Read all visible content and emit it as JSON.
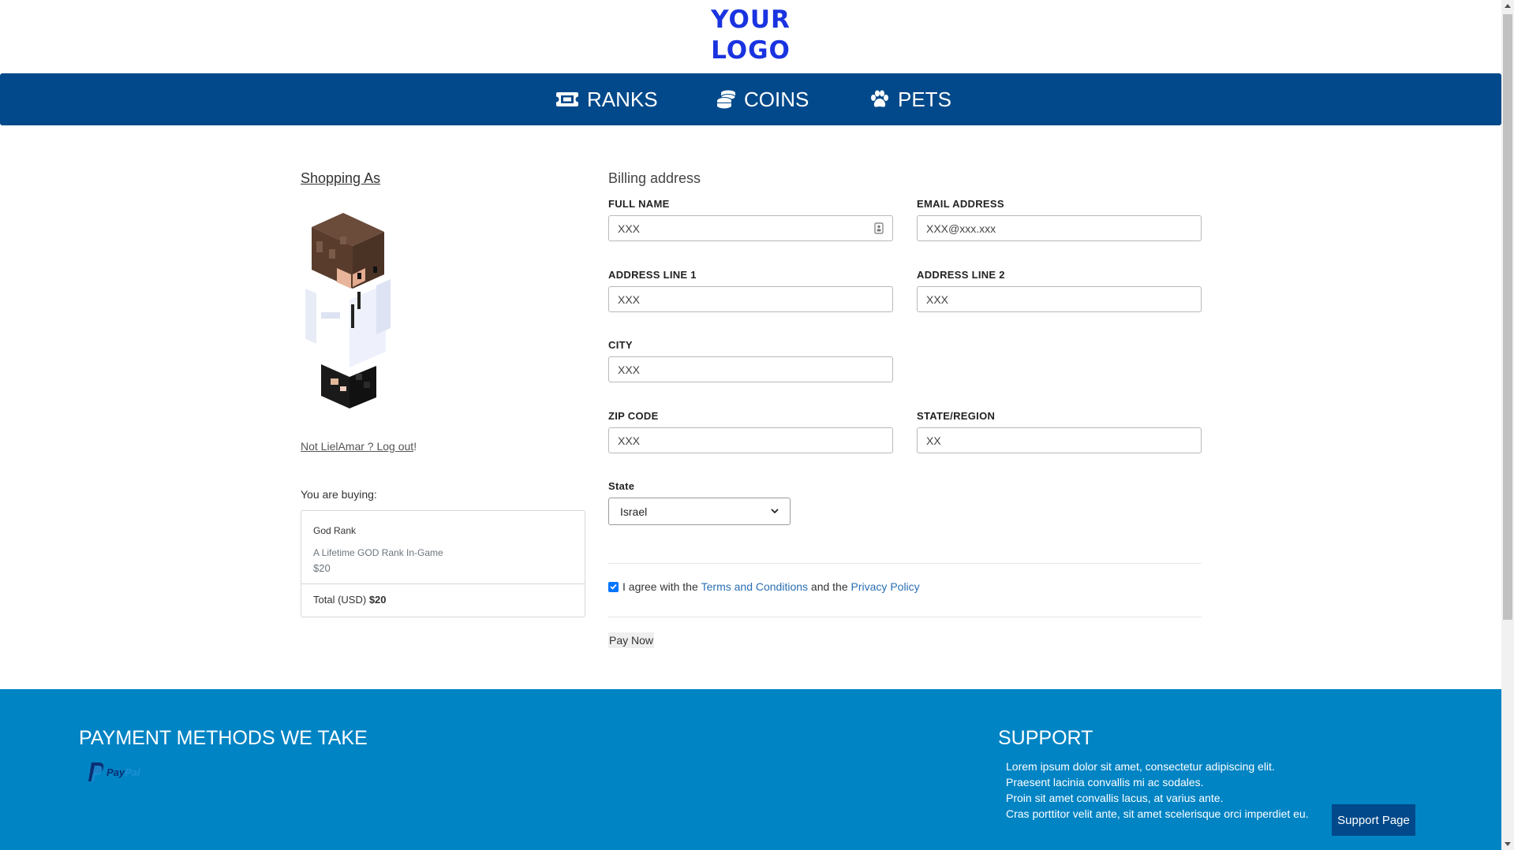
{
  "header": {
    "logo_line1": "YOUR",
    "logo_line2": "LOGO"
  },
  "nav": {
    "items": [
      {
        "label": "RANKS",
        "icon": "ticket-icon"
      },
      {
        "label": "COINS",
        "icon": "coins-icon"
      },
      {
        "label": "PETS",
        "icon": "paw-icon"
      }
    ]
  },
  "account": {
    "heading": "Shopping As",
    "logout_text": "Not LielAmar ? Log out",
    "logout_suffix": "!"
  },
  "cart": {
    "label": "You are buying:",
    "item_name": "God Rank",
    "item_description": "A Lifetime GOD Rank In-Game",
    "item_price": "$20",
    "total_label": "Total (USD)",
    "total_value": "$20"
  },
  "billing": {
    "title": "Billing address",
    "full_name_label": "FULL NAME",
    "full_name_value": "XXX",
    "email_label": "EMAIL ADDRESS",
    "email_value": "XXX@xxx.xxx",
    "address1_label": "ADDRESS LINE 1",
    "address1_value": "XXX",
    "address2_label": "ADDRESS LINE 2",
    "address2_value": "XXX",
    "city_label": "CITY",
    "city_value": "XXX",
    "zip_label": "ZIP CODE",
    "zip_value": "XXX",
    "region_label": "STATE/REGION",
    "region_value": "XX",
    "state_label": "State",
    "state_value": "Israel"
  },
  "agreement": {
    "checked": true,
    "prefix": "I agree with the",
    "terms_link": "Terms and Conditions",
    "middle": "and the",
    "privacy_link": "Privacy Policy"
  },
  "pay_button": "Pay Now",
  "footer": {
    "payment_heading": "PAYMENT METHODS WE TAKE",
    "paypal_text_1": "Pay",
    "paypal_text_2": "Pal",
    "support_heading": "SUPPORT",
    "support_lines": [
      "Lorem ipsum dolor sit amet, consectetur adipiscing elit.",
      "Praesent lacinia convallis mi ac sodales.",
      "Proin sit amet convallis lacus, at varius ante.",
      "Cras porttitor velit ante, sit amet scelerisque orci imperdiet eu."
    ],
    "support_button": "Support Page"
  },
  "colors": {
    "navbar": "#01498a",
    "footer": "#0184c4",
    "logo": "#1a33e0",
    "link": "#2a6fb3"
  }
}
